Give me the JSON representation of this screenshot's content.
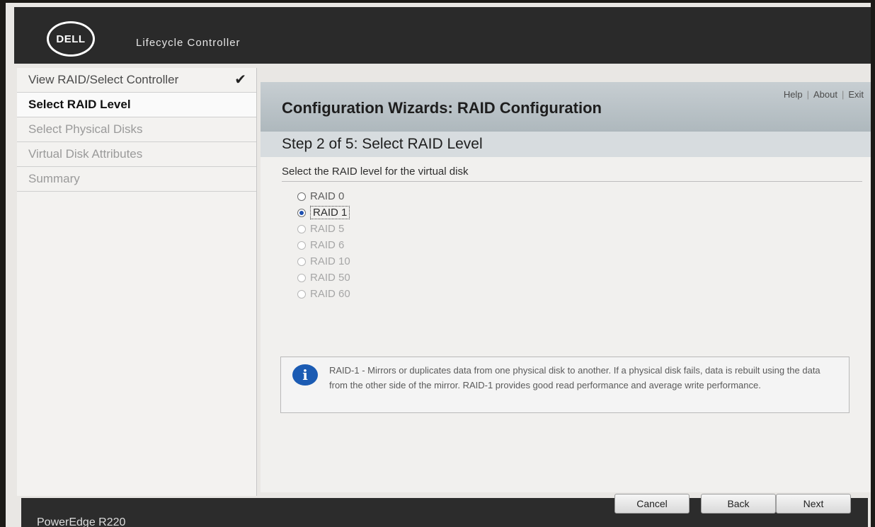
{
  "header": {
    "logo_text": "DELL",
    "product_name": "Lifecycle Controller"
  },
  "sidebar": {
    "items": [
      {
        "label": "View RAID/Select Controller",
        "state": "completed"
      },
      {
        "label": "Select RAID Level",
        "state": "current"
      },
      {
        "label": "Select Physical Disks",
        "state": "pending"
      },
      {
        "label": "Virtual Disk Attributes",
        "state": "pending"
      },
      {
        "label": "Summary",
        "state": "pending"
      }
    ]
  },
  "top_links": {
    "help": "Help",
    "about": "About",
    "exit": "Exit",
    "separator": "|"
  },
  "main": {
    "title": "Configuration Wizards: RAID Configuration",
    "step": "Step 2 of 5: Select RAID Level",
    "instruction": "Select the RAID level for the virtual disk",
    "raid_options": [
      {
        "label": "RAID 0",
        "selected": false,
        "enabled": true
      },
      {
        "label": "RAID 1",
        "selected": true,
        "enabled": true
      },
      {
        "label": "RAID 5",
        "selected": false,
        "enabled": false
      },
      {
        "label": "RAID 6",
        "selected": false,
        "enabled": false
      },
      {
        "label": "RAID 10",
        "selected": false,
        "enabled": false
      },
      {
        "label": "RAID 50",
        "selected": false,
        "enabled": false
      },
      {
        "label": "RAID 60",
        "selected": false,
        "enabled": false
      }
    ],
    "info": {
      "icon": "info-icon",
      "text": "RAID-1 - Mirrors or duplicates data from one physical disk to another. If a physical disk fails, data is rebuilt using the data from the other side of the mirror. RAID-1 provides good read performance and average write performance."
    }
  },
  "footer": {
    "model": "PowerEdge R220",
    "cancel_label": "Cancel",
    "back_label": "Back",
    "next_label": "Next"
  },
  "colors": {
    "header_bg": "#2a2a2a",
    "selected_radio": "#1d4fb0",
    "info_icon": "#1b5bb3"
  }
}
